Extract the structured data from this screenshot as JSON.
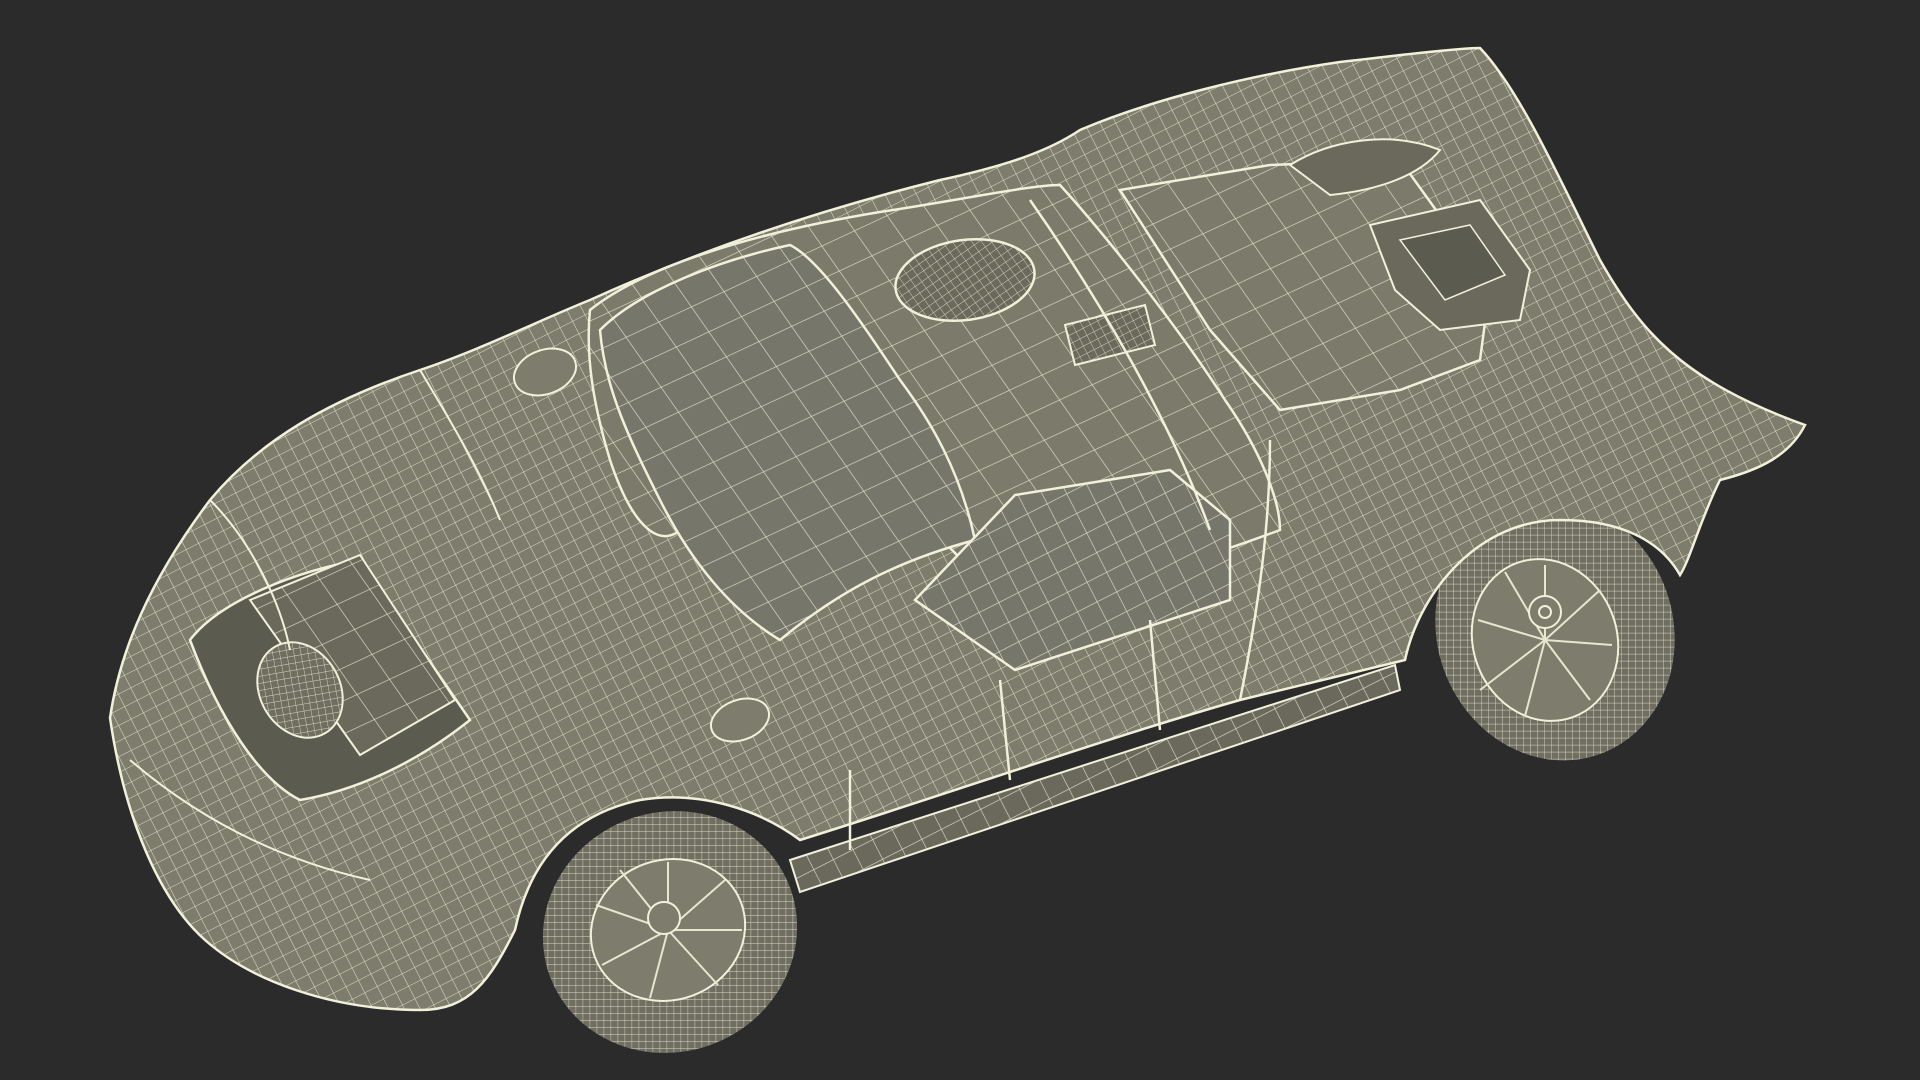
{
  "scene": {
    "subject": "sports-car-wireframe-render",
    "colors": {
      "background": "#2b2b2b",
      "body_fill": "#7d7c6d",
      "body_fill_dark": "#6a695c",
      "shadow_fill": "#5c5b50",
      "wire": "#e7e6cf",
      "wire_strong": "#f1f0da"
    }
  }
}
